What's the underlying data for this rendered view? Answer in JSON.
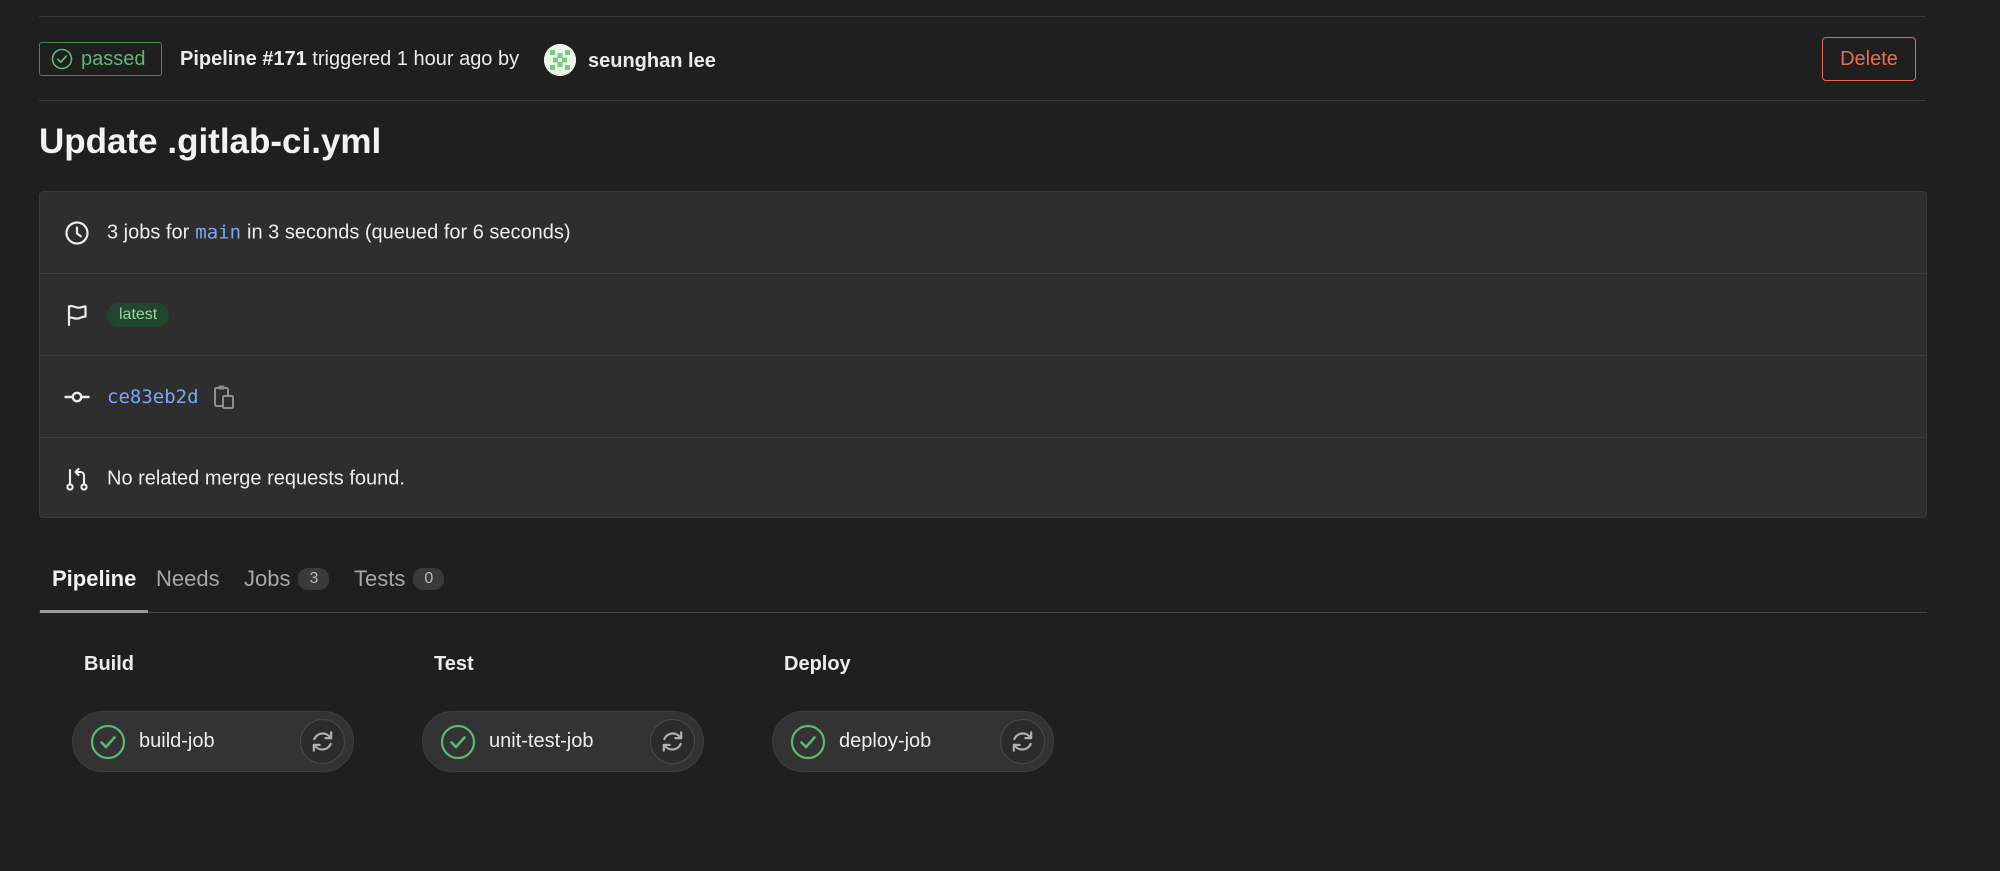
{
  "header": {
    "status": "passed",
    "pipeline_label": "Pipeline #171",
    "triggered_text": " triggered 1 hour ago by",
    "author": "seunghan lee",
    "delete_label": "Delete"
  },
  "title": "Update .gitlab-ci.yml",
  "info": {
    "jobs_prefix": "3 jobs for",
    "ref": "main",
    "jobs_suffix": "in 3 seconds (queued for 6 seconds)",
    "tag": "latest",
    "commit_sha": "ce83eb2d",
    "merge_requests": "No related merge requests found."
  },
  "tabs": [
    {
      "label": "Pipeline",
      "active": true
    },
    {
      "label": "Needs"
    },
    {
      "label": "Jobs",
      "count": "3"
    },
    {
      "label": "Tests",
      "count": "0"
    }
  ],
  "stages": [
    {
      "name": "Build",
      "job": "build-job",
      "status": "success"
    },
    {
      "name": "Test",
      "job": "unit-test-job",
      "status": "success"
    },
    {
      "name": "Deploy",
      "job": "deploy-job",
      "status": "success"
    }
  ],
  "icons": {
    "status": "check-circle-icon",
    "duration": "clock-icon",
    "tag": "flag-icon",
    "commit": "commit-icon",
    "merge_request": "merge-request-icon",
    "copy": "clipboard-icon",
    "retry": "retry-icon"
  },
  "colors": {
    "success": "#5cb878",
    "danger": "#e86d5a",
    "link": "#7aa6f5",
    "background": "#1f1f1f",
    "card": "#2e2e2e"
  }
}
